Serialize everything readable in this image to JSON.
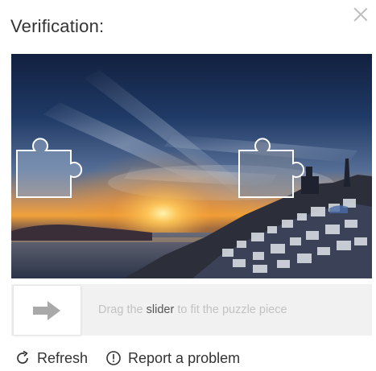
{
  "header": {
    "title": "Verification:"
  },
  "close": {
    "icon": "close-icon"
  },
  "slider": {
    "hint_before": "Drag the ",
    "hint_bold": "slider",
    "hint_after": " to fit the puzzle piece",
    "icon": "arrow-right-icon"
  },
  "footer": {
    "refresh_label": "Refresh",
    "refresh_icon": "refresh-icon",
    "report_label": "Report a problem",
    "report_icon": "info-circle-icon"
  },
  "colors": {
    "sky_top": "#16264a",
    "sunset": "#f2a33a",
    "sea": "#2b3a52",
    "track": "#f1f1f1",
    "hint": "#c2c2c2"
  }
}
